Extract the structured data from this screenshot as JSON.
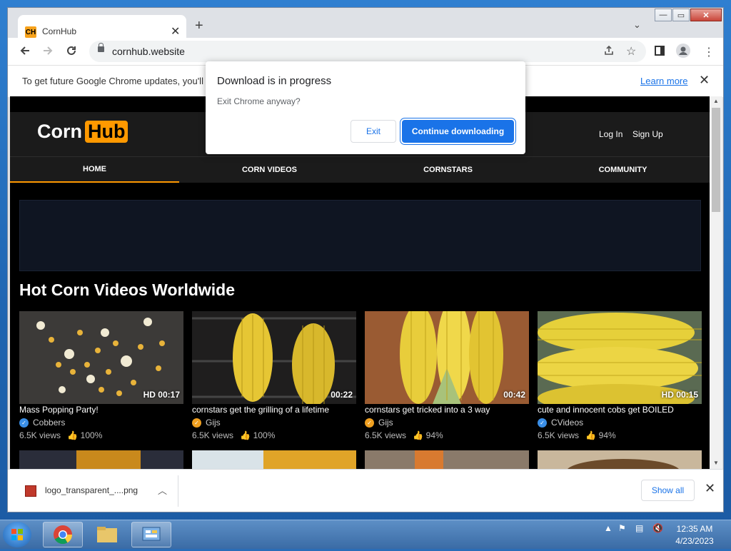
{
  "browser": {
    "tab_favicon": "CH",
    "tab_title": "CornHub",
    "tab_close": "✕",
    "new_tab": "+",
    "url": "cornhub.website",
    "window_buttons": [
      "—",
      "▭",
      "✕"
    ]
  },
  "infobar": {
    "text": "To get future Google Chrome updates, you'll",
    "learn_more": "Learn more",
    "close": "✕"
  },
  "dialog": {
    "title": "Download is in progress",
    "body": "Exit Chrome anyway?",
    "exit_label": "Exit",
    "continue_label": "Continue downloading"
  },
  "site": {
    "logo_part1": "Corn",
    "logo_part2": "Hub",
    "login": "Log In",
    "signup": "Sign Up",
    "nav": [
      "HOME",
      "CORN VIDEOS",
      "CORNSTARS",
      "COMMUNITY"
    ],
    "section_title": "Hot Corn Videos Worldwide",
    "videos": [
      {
        "title": "Mass Popping Party!",
        "channel": "Cobbers",
        "channel_badge": "verified-blue",
        "duration": "HD 00:17",
        "views": "6.5K views",
        "rating": "100%"
      },
      {
        "title": "cornstars get the grilling of a lifetime",
        "channel": "Gijs",
        "channel_badge": "verified-orange",
        "duration": "00:22",
        "views": "6.5K views",
        "rating": "100%"
      },
      {
        "title": "cornstars get tricked into a 3 way",
        "channel": "Gijs",
        "channel_badge": "verified-orange",
        "duration": "00:42",
        "views": "6.5K views",
        "rating": "94%"
      },
      {
        "title": "cute and innocent cobs get BOILED",
        "channel": "CVideos",
        "channel_badge": "verified-blue",
        "duration": "HD 00:15",
        "views": "6.5K views",
        "rating": "94%"
      }
    ]
  },
  "downloads": {
    "file_name": "logo_transparent_....png",
    "show_all": "Show all",
    "close": "✕"
  },
  "taskbar": {
    "time": "12:35 AM",
    "date": "4/23/2023"
  },
  "colors": {
    "accent": "#ff9900",
    "chrome_blue": "#1a73e8",
    "site_bg": "#000000",
    "header_bg": "#1b1b1b"
  }
}
